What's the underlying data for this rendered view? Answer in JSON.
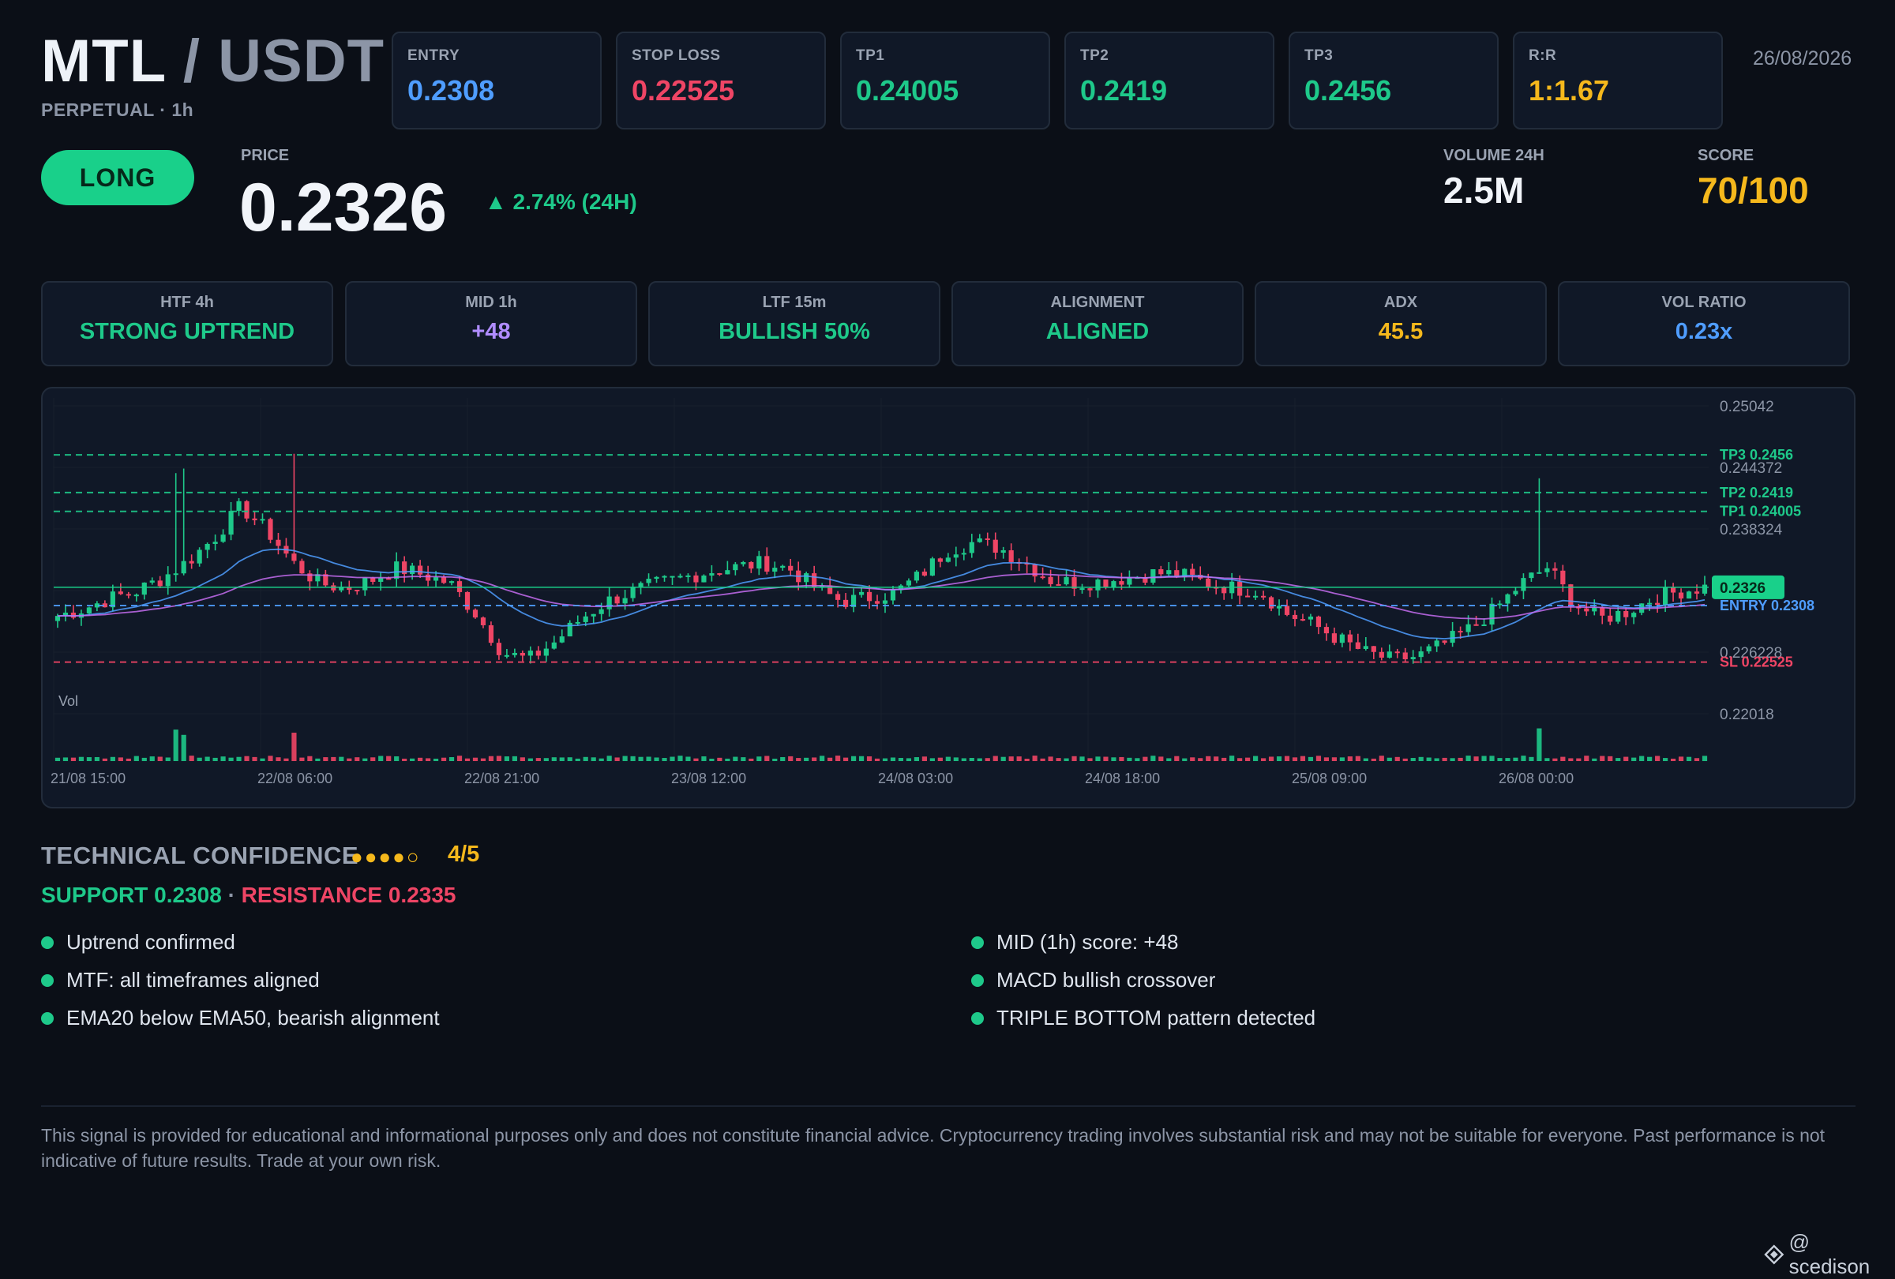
{
  "header": {
    "base": "MTL",
    "separator": "/",
    "quote": "USDT",
    "subtitle": "PERPETUAL · 1h",
    "date": "26/08/2026"
  },
  "kpis": [
    {
      "label": "ENTRY",
      "value": "0.2308",
      "color": "#4f9dff"
    },
    {
      "label": "STOP LOSS",
      "value": "0.22525",
      "color": "#ef4565"
    },
    {
      "label": "TP1",
      "value": "0.24005",
      "color": "#1ec98a"
    },
    {
      "label": "TP2",
      "value": "0.2419",
      "color": "#1ec98a"
    },
    {
      "label": "TP3",
      "value": "0.2456",
      "color": "#1ec98a"
    },
    {
      "label": "R:R",
      "value": "1:1.67",
      "color": "#f5b81c"
    }
  ],
  "signal": {
    "direction": "LONG",
    "price_label": "PRICE",
    "price": "0.2326",
    "change": "▲ 2.74% (24H)",
    "volume_label": "VOLUME 24H",
    "volume": "2.5M",
    "score_label": "SCORE",
    "score": "70/100"
  },
  "metrics": [
    {
      "label": "HTF 4h",
      "value": "STRONG UPTREND",
      "color": "#1ec98a"
    },
    {
      "label": "MID 1h",
      "value": "+48",
      "color": "#b08cff"
    },
    {
      "label": "LTF 15m",
      "value": "BULLISH 50%",
      "color": "#1ec98a"
    },
    {
      "label": "ALIGNMENT",
      "value": "ALIGNED",
      "color": "#1ec98a"
    },
    {
      "label": "ADX",
      "value": "45.5",
      "color": "#f5b81c"
    },
    {
      "label": "VOL RATIO",
      "value": "0.23x",
      "color": "#4f9dff"
    }
  ],
  "chart_data": {
    "type": "candlestick",
    "y_tick_labels": [
      "0.25042",
      "0.244372",
      "0.238324",
      "0.232276",
      "0.226228",
      "0.22018"
    ],
    "ylim": [
      0.22018,
      0.25042
    ],
    "x_tick_labels": [
      "21/08 15:00",
      "22/08 06:00",
      "22/08 21:00",
      "23/08 12:00",
      "24/08 03:00",
      "24/08 18:00",
      "25/08 09:00",
      "26/08 00:00"
    ],
    "volume_label": "Vol",
    "levels": [
      {
        "name": "TP3",
        "label": "TP3 0.2456",
        "value": 0.2456,
        "color": "#1ec98a"
      },
      {
        "name": "TP2",
        "label": "TP2 0.2419",
        "value": 0.2419,
        "color": "#1ec98a"
      },
      {
        "name": "TP1",
        "label": "TP1 0.24005",
        "value": 0.24005,
        "color": "#1ec98a"
      },
      {
        "name": "ENTRY",
        "label": "ENTRY 0.2308",
        "value": 0.2308,
        "color": "#4f9dff"
      },
      {
        "name": "SL",
        "label": "SL 0.22525",
        "value": 0.22525,
        "color": "#ef4565"
      }
    ],
    "current_price": {
      "label": "0.2326",
      "value": 0.2326,
      "color": "#19d08a"
    },
    "anchors": [
      0.2298,
      0.2305,
      0.2315,
      0.2322,
      0.2335,
      0.2352,
      0.2375,
      0.2405,
      0.2382,
      0.235,
      0.233,
      0.2325,
      0.2333,
      0.2345,
      0.2338,
      0.233,
      0.23,
      0.2262,
      0.2255,
      0.2272,
      0.2295,
      0.2312,
      0.2322,
      0.233,
      0.2336,
      0.2342,
      0.2346,
      0.235,
      0.2344,
      0.2325,
      0.2312,
      0.2316,
      0.232,
      0.2338,
      0.2362,
      0.237,
      0.2365,
      0.235,
      0.2333,
      0.233,
      0.2332,
      0.2336,
      0.234,
      0.2338,
      0.233,
      0.2325,
      0.2322,
      0.23,
      0.229,
      0.2275,
      0.2262,
      0.2255,
      0.2258,
      0.227,
      0.2285,
      0.2305,
      0.233,
      0.2346,
      0.231,
      0.2295,
      0.2302,
      0.2315,
      0.2322,
      0.2326
    ],
    "volume_profile": "low and uniform with spikes near 21/08 late, 22/08 06:00 and 26/08 after 00:00"
  },
  "confidence": {
    "title": "TECHNICAL CONFIDENCE",
    "dots": "●●●●○",
    "score": "4/5",
    "support": "SUPPORT 0.2308",
    "separator": "·",
    "resistance": "RESISTANCE 0.2335",
    "left_points": [
      "Uptrend confirmed",
      "MTF: all timeframes aligned",
      "EMA20 below EMA50, bearish alignment"
    ],
    "right_points": [
      "MID (1h) score: +48",
      "MACD bullish crossover",
      "TRIPLE BOTTOM pattern detected"
    ]
  },
  "disclaimer": "This signal is provided for educational and informational purposes only and does not constitute financial advice. Cryptocurrency trading involves substantial risk and may not be suitable for everyone. Past performance is not indicative of future results. Trade at your own risk.",
  "watermark": "@ scedison",
  "icons": {
    "watermark_icon": "diamond-icon"
  }
}
